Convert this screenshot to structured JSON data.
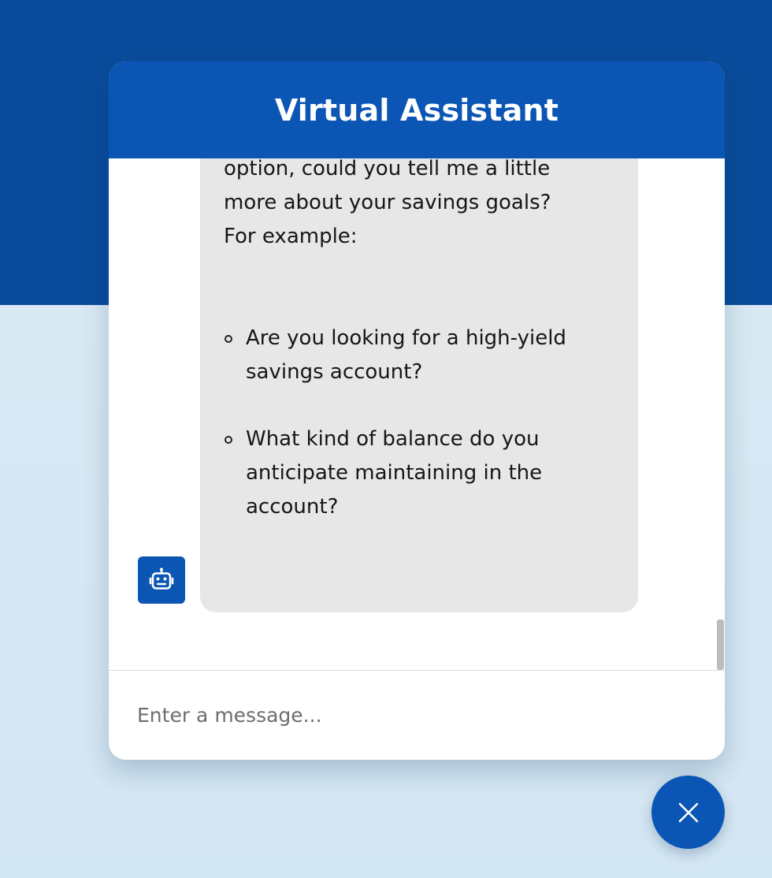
{
  "header": {
    "title": "Virtual Assistant"
  },
  "message": {
    "lines": [
      "option, could you tell me a little",
      "more about your savings goals?",
      "For example:"
    ],
    "list_items": [
      {
        "lines": [
          "Are you looking for a high-yield",
          "savings account?"
        ]
      },
      {
        "lines": [
          "What kind of balance do you",
          "anticipate maintaining in the",
          "account?"
        ]
      }
    ],
    "avatar_icon": "robot-icon"
  },
  "input": {
    "placeholder": "Enter a message..."
  },
  "close_button": {
    "icon": "close-icon"
  },
  "colors": {
    "brand_blue": "#0b56b4",
    "page_top": "#0a4c9c",
    "page_bottom": "#d6e7f3",
    "bubble": "#e7e7e7"
  }
}
